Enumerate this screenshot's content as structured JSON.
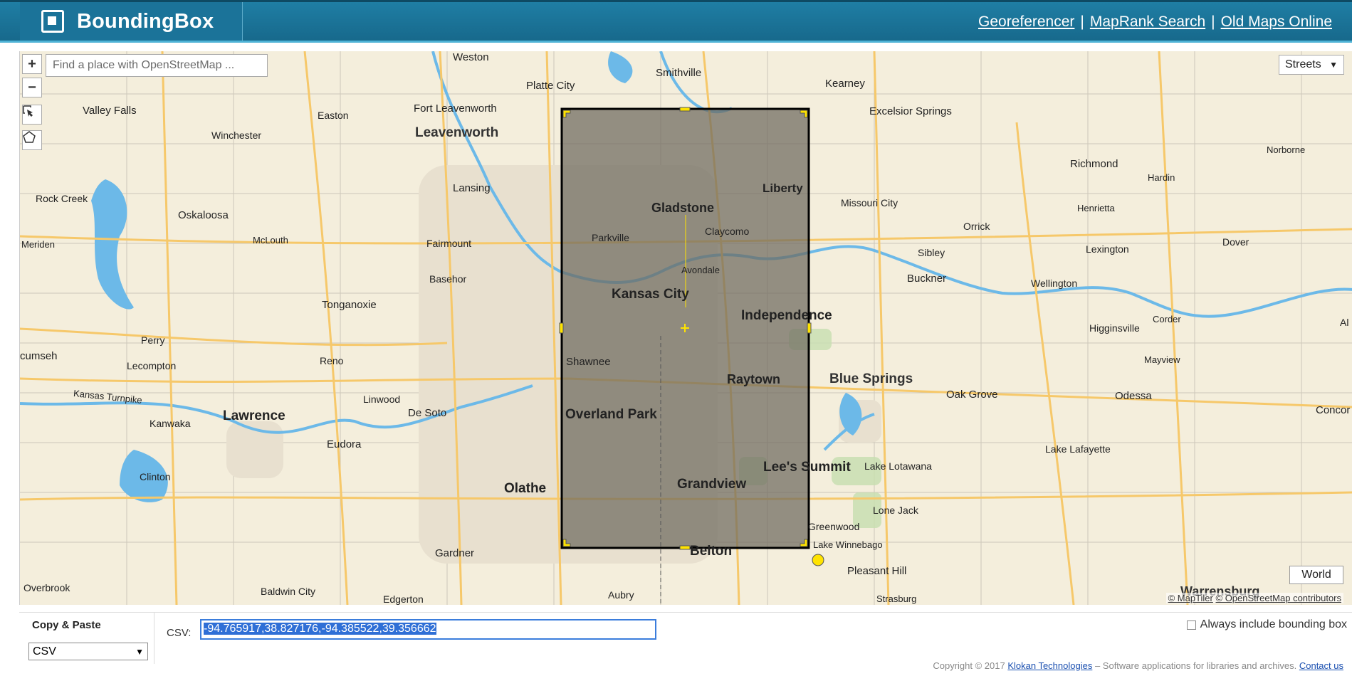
{
  "header": {
    "brand": "BoundingBox",
    "links": [
      "Georeferencer",
      "MapRank Search",
      "Old Maps Online"
    ],
    "separator": "|"
  },
  "map": {
    "search_placeholder": "Find a place with OpenStreetMap ...",
    "zoom_in": "+",
    "zoom_out": "−",
    "layer": "Streets",
    "world_button": "World",
    "attribution": [
      "© MapTiler",
      "© OpenStreetMap contributors"
    ],
    "place_labels": [
      "Weston",
      "Smithville",
      "Kearney",
      "Platte City",
      "Valley Falls",
      "Easton",
      "Fort Leavenworth",
      "Excelsior Springs",
      "Winchester",
      "Leavenworth",
      "Norborne",
      "Richmond",
      "Hardin",
      "Liberty",
      "Lansing",
      "Rock Creek",
      "Gladstone",
      "Missouri City",
      "Henrietta",
      "Oskaloosa",
      "Claycomo",
      "Orrick",
      "Meriden",
      "McLouth",
      "Fairmount",
      "Parkville",
      "Lexington",
      "Dover",
      "Sibley",
      "Avondale",
      "Basehor",
      "Buckner",
      "Wellington",
      "Kansas City",
      "Tonganoxie",
      "Independence",
      "Corder",
      "Higginsville",
      "Perry",
      "cumseh",
      "Shawnee",
      "Reno",
      "Mayview",
      "Lecompton",
      "Raytown",
      "Blue Springs",
      "Kansas Turnpike",
      "Linwood",
      "Oak Grove",
      "Odessa",
      "Concor",
      "Kanwaka",
      "Lawrence",
      "De Soto",
      "Overland Park",
      "Lake Lafayette",
      "Eudora",
      "Lee's Summit",
      "Lake Lotawana",
      "Clinton",
      "Olathe",
      "Grandview",
      "Lone Jack",
      "Greenwood",
      "Gardner",
      "Lake Winnebago",
      "Belton",
      "Pleasant Hill",
      "Overbrook",
      "Baldwin City",
      "Aubry",
      "Edgerton",
      "Strasburg",
      "Warrensburg",
      "Al"
    ]
  },
  "panel": {
    "title": "Copy & Paste",
    "format": "CSV",
    "csv_label": "CSV:",
    "csv_value": "-94.765917,38.827176,-94.385522,39.356662",
    "checkbox_label": "Always include bounding box"
  },
  "footer": {
    "copyright": "Copyright © 2017",
    "company": "Klokan Technologies",
    "tagline": " – Software applications for libraries and archives.",
    "contact": "Contact us"
  },
  "colors": {
    "header": "#1b7399",
    "map_bg": "#f4eedc",
    "water": "#6cb9e8",
    "road": "#f6c86a",
    "bbox_fill": "#6e6a5e",
    "handle": "#ffe300",
    "selection": "#2f6fd6"
  }
}
